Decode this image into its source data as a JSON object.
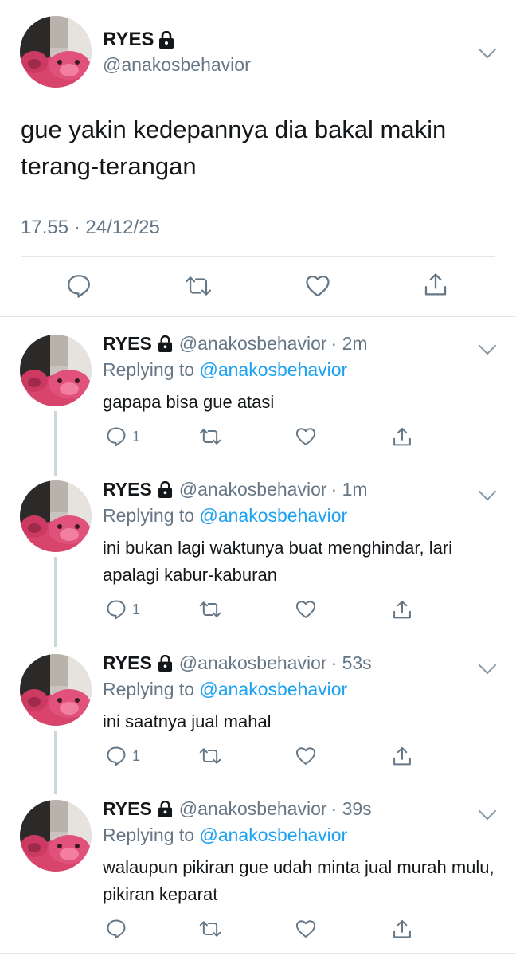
{
  "main_tweet": {
    "name": "RYES",
    "handle": "@anakosbehavior",
    "text": "gue yakin kedepannya dia bakal makin terang-terangan",
    "timestamp": "17.55 · 24/12/25",
    "icons": [
      "reply-icon",
      "retweet-icon",
      "like-icon",
      "share-icon"
    ]
  },
  "replies": [
    {
      "name": "RYES",
      "handle": "@anakosbehavior",
      "time": "· 2m",
      "replying_prefix": "Replying to",
      "replying_to": "@anakosbehavior",
      "text": "gapapa bisa gue atasi",
      "reply_count": "1"
    },
    {
      "name": "RYES",
      "handle": "@anakosbehavior",
      "time": "· 1m",
      "replying_prefix": "Replying to",
      "replying_to": "@anakosbehavior",
      "text": "ini bukan lagi waktunya buat menghindar, lari apalagi kabur-kaburan",
      "reply_count": "1"
    },
    {
      "name": "RYES",
      "handle": "@anakosbehavior",
      "time": "· 53s",
      "replying_prefix": "Replying to",
      "replying_to": "@anakosbehavior",
      "text": "ini saatnya jual mahal",
      "reply_count": "1"
    },
    {
      "name": "RYES",
      "handle": "@anakosbehavior",
      "time": "· 39s",
      "replying_prefix": "Replying to",
      "replying_to": "@anakosbehavior",
      "text": "walaupun pikiran gue udah minta jual murah mulu, pikiran keparat",
      "reply_count": ""
    }
  ],
  "colors": {
    "text": "#14171a",
    "secondary": "#657786",
    "link": "#1da1f2",
    "divider": "#e1e8ed",
    "avatar_pink": "#d8446b"
  }
}
